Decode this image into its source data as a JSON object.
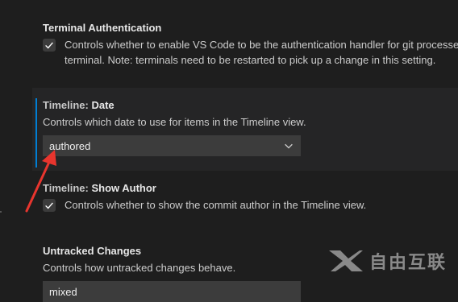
{
  "terminal_auth": {
    "title": "Terminal Authentication",
    "checked": true,
    "line1": "Controls whether to enable VS Code to be the authentication handler for git processes",
    "line2": "terminal. Note: terminals need to be restarted to pick up a change in this setting."
  },
  "timeline_date": {
    "category": "Timeline: ",
    "name": "Date",
    "description": "Controls which date to use for items in the Timeline view.",
    "value": "authored"
  },
  "timeline_author": {
    "category": "Timeline: ",
    "name": "Show Author",
    "checked": true,
    "description": "Controls whether to show the commit author in the Timeline view."
  },
  "untracked": {
    "title": "Untracked Changes",
    "description": "Controls how untracked changes behave.",
    "value": "mixed"
  },
  "annotation": {
    "color": "#e8352e"
  },
  "watermark": {
    "text": "自由互联",
    "icon": "x-logo-icon"
  },
  "colors": {
    "accent": "#007fd4",
    "background": "#1e1e1e",
    "focused_bg": "#252526"
  }
}
